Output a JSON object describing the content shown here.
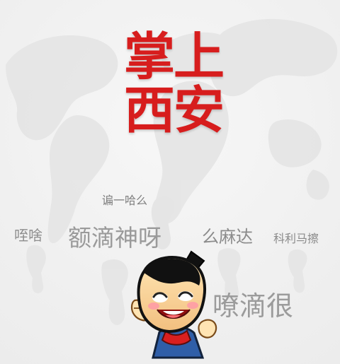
{
  "splash": {
    "logo_lines": [
      "掌上",
      "西安"
    ],
    "words": [
      "谝一哈么",
      "咥啥",
      "额滴神呀",
      "么麻达",
      "科利马擦",
      "嘹滴很"
    ]
  },
  "colors": {
    "background": "#f3f3f3",
    "logo_red": "#d71d1d",
    "word_gray": "#9a9a9a",
    "mascot_hat": "#111111",
    "mascot_shirt": "#2f5ea8",
    "mascot_scarf": "#d91f1f",
    "mascot_face": "#f6c98f"
  },
  "icons": {
    "background": "world-map-icon",
    "mascot": "cartoon-mascot-icon"
  }
}
